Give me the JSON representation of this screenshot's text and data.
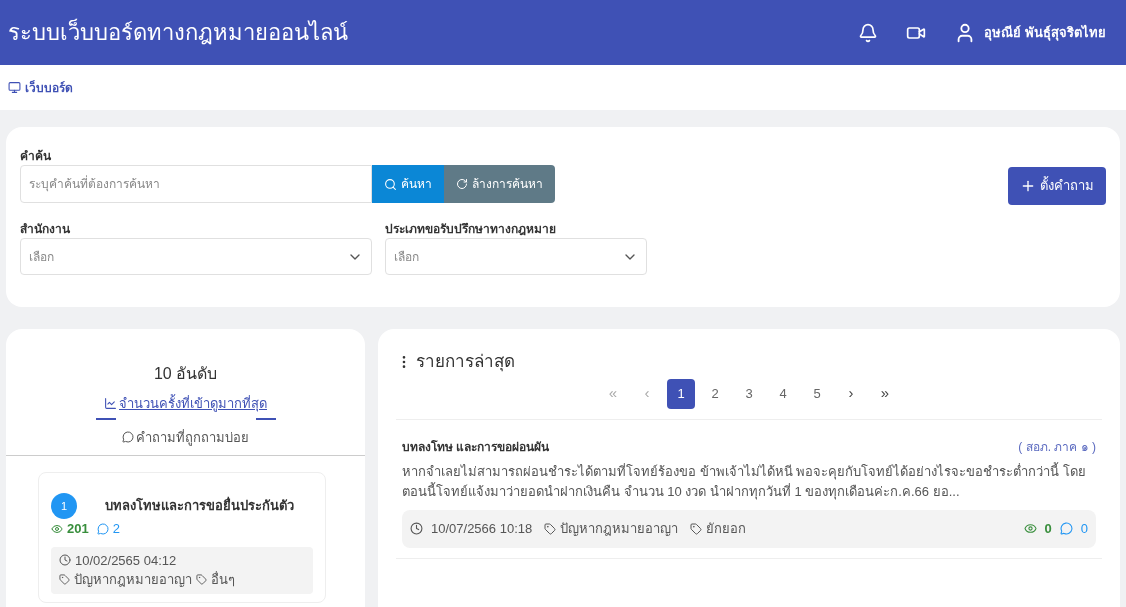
{
  "header": {
    "title": "ระบบเว็บบอร์ดทางกฎหมายออนไลน์",
    "user": "อุษณีย์ พันธุ์สุจริตไทย"
  },
  "breadcrumb": "เว็บบอร์ด",
  "filters": {
    "search_label": "คำค้น",
    "search_placeholder": "ระบุคำค้นที่ต้องการค้นหา",
    "search_button": "ค้นหา",
    "clear_button": "ล้างการค้นหา",
    "ask_button": "ตั้งคำถาม",
    "selects": [
      {
        "label": "สำนักงาน",
        "placeholder": "เลือก"
      },
      {
        "label": "ประเภทขอรับปรึกษาทางกฎหมาย",
        "placeholder": "เลือก"
      }
    ]
  },
  "top": {
    "title": "10 อันดับ",
    "tabs": [
      {
        "label": "จำนวนครั้งที่เข้าดูมากที่สุด",
        "kind": "views",
        "selected": true
      },
      {
        "label": "คำถามที่ถูกถามบ่อย",
        "kind": "faq",
        "selected": false
      }
    ],
    "items": [
      {
        "rank": "1",
        "title": "บทลงโทษและการขอยื่นประกันตัว",
        "views": "201",
        "comments": "2",
        "date": "10/02/2565 04:12",
        "tags": [
          "ปัญหากฎหมายอาญา",
          "อื่นๆ"
        ]
      }
    ]
  },
  "latest": {
    "title": "รายการล่าสุด",
    "pages": [
      {
        "label": "«",
        "kind": "first",
        "selected": false
      },
      {
        "label": "‹",
        "kind": "prev",
        "selected": false
      },
      {
        "label": "1",
        "kind": "page",
        "selected": true
      },
      {
        "label": "2",
        "kind": "page",
        "selected": false
      },
      {
        "label": "3",
        "kind": "page",
        "selected": false
      },
      {
        "label": "4",
        "kind": "page",
        "selected": false
      },
      {
        "label": "5",
        "kind": "page",
        "selected": false
      },
      {
        "label": "›",
        "kind": "next",
        "selected": false
      },
      {
        "label": "»",
        "kind": "last",
        "selected": false
      }
    ],
    "posts": [
      {
        "title": "บทลงโทษ และการขอผ่อนผัน",
        "office": "( สอภ. ภาค ๑ )",
        "body": "หากจำเลยไม่สามารถผ่อนชำระได้ตามที่โจทย์ร้องขอ ข้าพเจ้าไม่ได้หนี พอจะคุยกับโจทย์ได้อย่างไรจะขอชำระต่ำกว่านี้ โดยตอนนี้โจทย์แจ้งมาว่ายอดนำฝากเงินคืน จำนวน 10 งวด นำฝากทุกวันที่ 1 ของทุกเดือนค่ะก.ค.66 ยอ...",
        "date": "10/07/2566 10:18",
        "tags": [
          "ปัญหากฎหมายอาญา",
          "ยักยอก"
        ],
        "views": "0",
        "comments": "0"
      }
    ]
  }
}
